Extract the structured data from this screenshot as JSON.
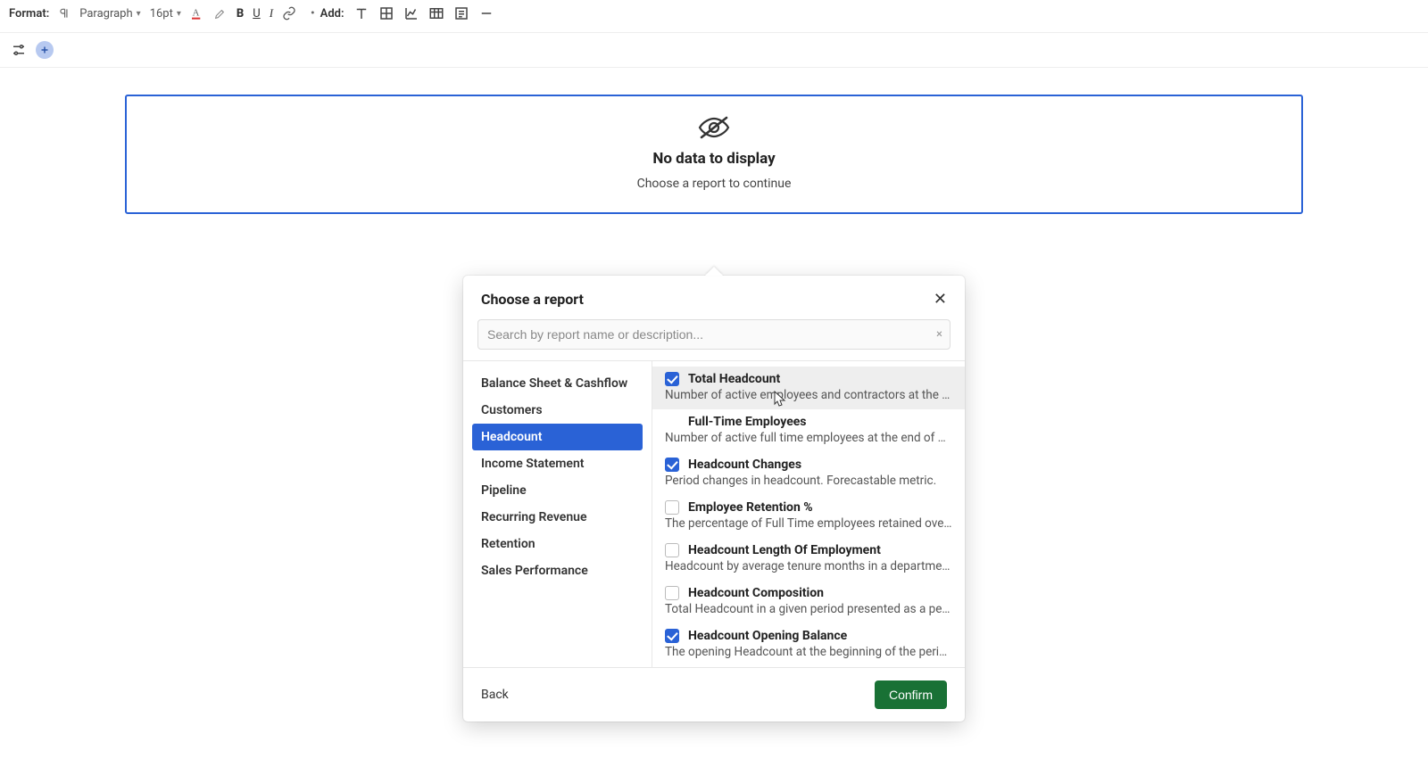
{
  "toolbar": {
    "format_label": "Format:",
    "paragraph_label": "Paragraph",
    "font_size": "16pt",
    "add_label": "Add:"
  },
  "placeholder": {
    "title": "No data to display",
    "subtitle": "Choose a report to continue"
  },
  "dialog": {
    "title": "Choose a report",
    "search_placeholder": "Search by report name or description...",
    "back_label": "Back",
    "confirm_label": "Confirm",
    "categories": [
      {
        "label": "Balance Sheet & Cashflow",
        "selected": false
      },
      {
        "label": "Customers",
        "selected": false
      },
      {
        "label": "Headcount",
        "selected": true
      },
      {
        "label": "Income Statement",
        "selected": false
      },
      {
        "label": "Pipeline",
        "selected": false
      },
      {
        "label": "Recurring Revenue",
        "selected": false
      },
      {
        "label": "Retention",
        "selected": false
      },
      {
        "label": "Sales Performance",
        "selected": false
      }
    ],
    "reports": [
      {
        "name": "Total Headcount",
        "desc": "Number of active employees and contractors at the end of a given period.",
        "checked": true,
        "highlight": true,
        "has_checkbox": true
      },
      {
        "name": "Full-Time Employees",
        "desc": "Number of active full time employees at the end of a given period.",
        "checked": false,
        "highlight": false,
        "has_checkbox": false
      },
      {
        "name": "Headcount Changes",
        "desc": "Period changes in headcount. Forecastable metric.",
        "checked": true,
        "highlight": false,
        "has_checkbox": true
      },
      {
        "name": "Employee Retention %",
        "desc": "The percentage of Full Time employees retained over a given period.",
        "checked": false,
        "highlight": false,
        "has_checkbox": true
      },
      {
        "name": "Headcount Length Of Employment",
        "desc": "Headcount by average tenure months in a department",
        "checked": false,
        "highlight": false,
        "has_checkbox": true
      },
      {
        "name": "Headcount Composition",
        "desc": "Total Headcount in a given period presented as a percentage breakdown.",
        "checked": false,
        "highlight": false,
        "has_checkbox": true
      },
      {
        "name": "Headcount Opening Balance",
        "desc": "The opening Headcount at the beginning of the period for each department.",
        "checked": true,
        "highlight": false,
        "has_checkbox": true
      }
    ]
  }
}
